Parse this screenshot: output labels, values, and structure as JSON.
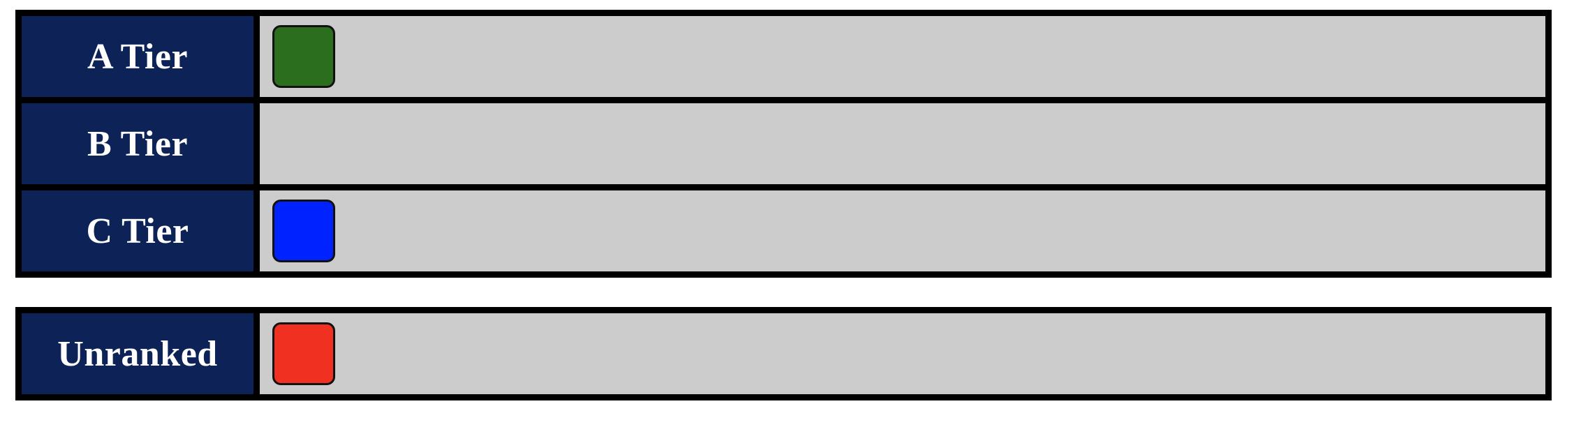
{
  "ranked_tiers": [
    {
      "label": "A Tier",
      "items": [
        {
          "color": "#2a6e1e",
          "name": "green"
        }
      ]
    },
    {
      "label": "B Tier",
      "items": []
    },
    {
      "label": "C Tier",
      "items": [
        {
          "color": "#0022ff",
          "name": "blue"
        }
      ]
    }
  ],
  "unranked": {
    "label": "Unranked",
    "items": [
      {
        "color": "#f03020",
        "name": "red"
      }
    ]
  },
  "colors": {
    "label_bg": "#0d2357",
    "drop_bg": "#cccccc",
    "border": "#000000"
  }
}
